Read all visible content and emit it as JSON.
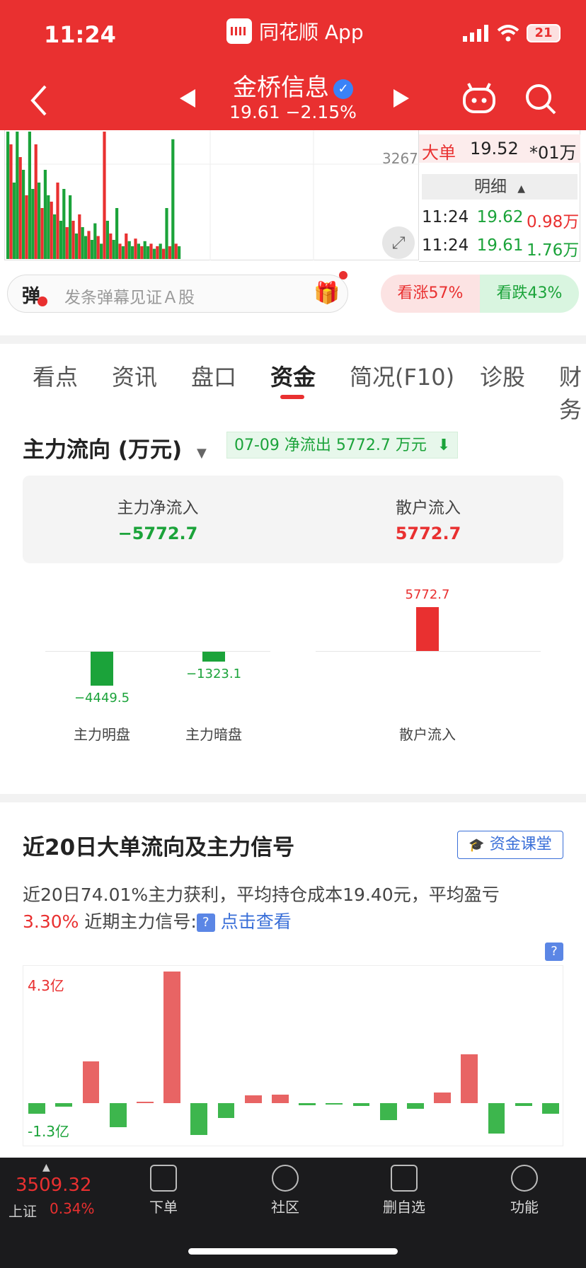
{
  "status": {
    "time": "11:24",
    "app_name": "同花顺 App",
    "battery": "21"
  },
  "stock": {
    "name": "金桥信息",
    "price_change": "19.61  −2.15%"
  },
  "chart_top": {
    "number": "3267",
    "volume_bars": [
      {
        "v": 1.0,
        "c": "g"
      },
      {
        "v": 0.9,
        "c": "r"
      },
      {
        "v": 0.6,
        "c": "g"
      },
      {
        "v": 1.0,
        "c": "g"
      },
      {
        "v": 0.8,
        "c": "r"
      },
      {
        "v": 0.7,
        "c": "g"
      },
      {
        "v": 0.5,
        "c": "r"
      },
      {
        "v": 1.0,
        "c": "g"
      },
      {
        "v": 0.55,
        "c": "g"
      },
      {
        "v": 0.9,
        "c": "r"
      },
      {
        "v": 0.6,
        "c": "g"
      },
      {
        "v": 0.4,
        "c": "r"
      },
      {
        "v": 0.7,
        "c": "g"
      },
      {
        "v": 0.5,
        "c": "g"
      },
      {
        "v": 0.45,
        "c": "r"
      },
      {
        "v": 0.35,
        "c": "g"
      },
      {
        "v": 0.6,
        "c": "r"
      },
      {
        "v": 0.3,
        "c": "g"
      },
      {
        "v": 0.55,
        "c": "g"
      },
      {
        "v": 0.25,
        "c": "r"
      },
      {
        "v": 0.5,
        "c": "g"
      },
      {
        "v": 0.3,
        "c": "r"
      },
      {
        "v": 0.2,
        "c": "g"
      },
      {
        "v": 0.35,
        "c": "r"
      },
      {
        "v": 0.25,
        "c": "g"
      },
      {
        "v": 0.18,
        "c": "g"
      },
      {
        "v": 0.22,
        "c": "r"
      },
      {
        "v": 0.15,
        "c": "g"
      },
      {
        "v": 0.28,
        "c": "g"
      },
      {
        "v": 0.18,
        "c": "r"
      },
      {
        "v": 0.12,
        "c": "g"
      },
      {
        "v": 1.0,
        "c": "r"
      },
      {
        "v": 0.3,
        "c": "g"
      },
      {
        "v": 0.2,
        "c": "r"
      },
      {
        "v": 0.15,
        "c": "g"
      },
      {
        "v": 0.4,
        "c": "g"
      },
      {
        "v": 0.12,
        "c": "r"
      },
      {
        "v": 0.1,
        "c": "g"
      },
      {
        "v": 0.2,
        "c": "r"
      },
      {
        "v": 0.14,
        "c": "g"
      },
      {
        "v": 0.1,
        "c": "g"
      },
      {
        "v": 0.16,
        "c": "r"
      },
      {
        "v": 0.12,
        "c": "g"
      },
      {
        "v": 0.1,
        "c": "r"
      },
      {
        "v": 0.14,
        "c": "g"
      },
      {
        "v": 0.1,
        "c": "g"
      },
      {
        "v": 0.12,
        "c": "r"
      },
      {
        "v": 0.08,
        "c": "g"
      },
      {
        "v": 0.1,
        "c": "r"
      },
      {
        "v": 0.12,
        "c": "g"
      },
      {
        "v": 0.08,
        "c": "r"
      },
      {
        "v": 0.4,
        "c": "g"
      },
      {
        "v": 0.1,
        "c": "r"
      },
      {
        "v": 0.94,
        "c": "g"
      },
      {
        "v": 0.12,
        "c": "r"
      },
      {
        "v": 0.1,
        "c": "g"
      }
    ]
  },
  "side_panel": {
    "big_order_label": "大单",
    "big_order_price": "19.52",
    "big_order_vol": "*01万",
    "detail_label": "明细",
    "ticks": [
      {
        "time": "11:24",
        "price": "19.62",
        "vol": "0.98万",
        "vol_color": "red"
      },
      {
        "time": "11:24",
        "price": "19.61",
        "vol": "1.76万",
        "vol_color": "green"
      }
    ]
  },
  "barrage": {
    "badge": "弹",
    "placeholder": "发条弹幕见证Ａ股"
  },
  "vote": {
    "up": "看涨57%",
    "down": "看跌43%"
  },
  "tabs": [
    "看点",
    "资讯",
    "盘口",
    "资金",
    "简况(F10)",
    "诊股",
    "财务"
  ],
  "flow": {
    "title": "主力流向 (万元)",
    "tag": "07-09 净流出 5772.7 万元",
    "main_net_label": "主力净流入",
    "main_net_value": "−5772.7",
    "retail_label": "散户流入",
    "retail_value": "5772.7",
    "chart_data": {
      "type": "bar",
      "categories": [
        "主力明盘",
        "主力暗盘",
        "散户流入"
      ],
      "values": [
        -4449.5,
        -1323.1,
        5772.7
      ],
      "value_labels": [
        "−4449.5",
        "−1323.1",
        "5772.7"
      ]
    }
  },
  "signals": {
    "title": "近20日大单流向及主力信号",
    "classroom_button": "资金课堂",
    "desc_text": "近20日74.01%主力获利，平均持仓成本19.40元，平均盈亏",
    "desc_pct": "3.30%",
    "desc_signal": "近期主力信号:",
    "desc_link": "点击查看",
    "qmark": "?",
    "chart_data": {
      "type": "bar",
      "y_max_label": "4.3亿",
      "y_min_label": "-1.3亿",
      "ylim": [
        -1.3,
        4.3
      ],
      "values": [
        -0.35,
        -0.12,
        1.35,
        -0.8,
        0.05,
        4.3,
        -1.05,
        -0.5,
        0.25,
        0.28,
        -0.08,
        -0.03,
        -0.1,
        -0.55,
        -0.2,
        0.35,
        1.6,
        -1.0,
        -0.1,
        -0.35
      ]
    }
  },
  "bottom_bar": {
    "index_value": "3509.32",
    "index_name": "上证",
    "index_change": "0.34%",
    "items": [
      "下单",
      "社区",
      "删自选",
      "功能"
    ]
  }
}
